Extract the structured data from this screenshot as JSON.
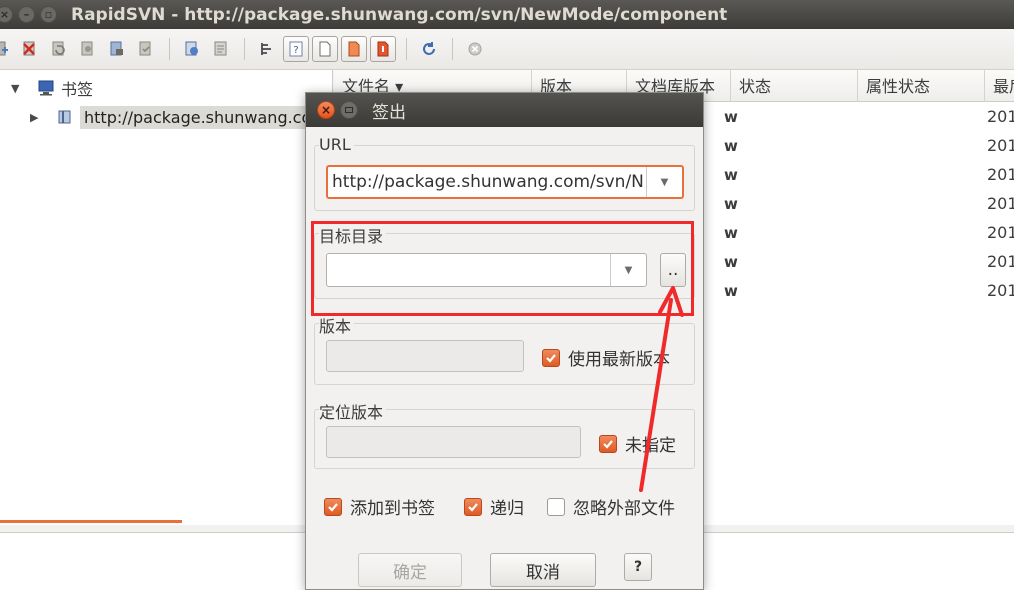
{
  "window": {
    "title": "RapidSVN - http://package.shunwang.com/svn/NewMode/component"
  },
  "toolbar": {
    "icons": [
      "add-icon",
      "delete-icon",
      "revert-icon",
      "resolve-icon",
      "lock-icon",
      "unlock-icon",
      "update-icon",
      "commit-icon",
      "log-icon",
      "info-icon",
      "file-view-icon",
      "flat-view-icon",
      "modified-icon",
      "conflict-icon",
      "refresh-icon",
      "stop-icon"
    ]
  },
  "tree": {
    "root_label": "书签",
    "child_label": "http://package.shunwang.com/svn/NewMode/component"
  },
  "list": {
    "columns": [
      "文件名 ▾",
      "版本",
      "文档库版本",
      "状态",
      "属性状态",
      "最后"
    ],
    "rows": [
      {
        "status": "w",
        "date": "201"
      },
      {
        "status": "w",
        "date": "201"
      },
      {
        "status": "w",
        "date": "201"
      },
      {
        "status": "w",
        "date": "201"
      },
      {
        "status": "w",
        "date": "201"
      },
      {
        "status": "w",
        "date": "201"
      },
      {
        "status": "w",
        "date": "201"
      }
    ]
  },
  "dialog": {
    "title": "签出",
    "url_label": "URL",
    "url_value": "http://package.shunwang.com/svn/NewMode/component",
    "target_label": "目标目录",
    "target_value": "",
    "browse_label": "..",
    "revision_label": "版本",
    "revision_value": "",
    "use_latest_label": "使用最新版本",
    "use_latest_checked": true,
    "peg_label": "定位版本",
    "peg_value": "",
    "unspecified_label": "未指定",
    "unspecified_checked": true,
    "add_bookmark_label": "添加到书签",
    "add_bookmark_checked": true,
    "recursive_label": "递归",
    "recursive_checked": true,
    "ignore_externals_label": "忽略外部文件",
    "ignore_externals_checked": false,
    "ok_label": "确定",
    "cancel_label": "取消",
    "help_label": "?"
  },
  "colors": {
    "accent": "#e8703a",
    "annotation": "#f02a2a",
    "titlebar": "#3d3c38"
  }
}
